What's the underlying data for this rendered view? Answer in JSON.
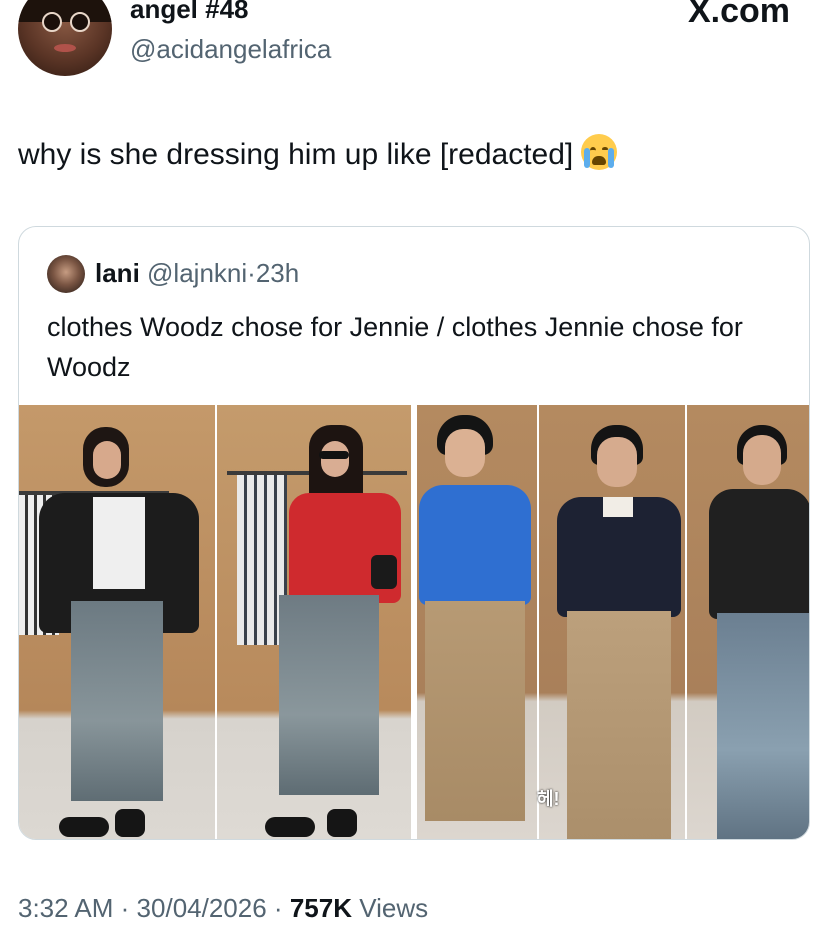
{
  "author": {
    "display_name": "angel #48",
    "handle": "@acidangelafrica"
  },
  "brand": "X.com",
  "tweet": {
    "text": "why is she dressing him up like [redacted]",
    "emoji": "loudly-crying-face"
  },
  "quoted_tweet": {
    "name": "lani",
    "handle": "@lajnkni",
    "separator": "·",
    "age": "23h",
    "text": "clothes Woodz chose for Jennie / clothes Jennie chose for Woodz"
  },
  "photos": [
    {
      "subject": "woman in leather jacket and denim maxi skirt"
    },
    {
      "subject": "woman in red cardigan and denim maxi skirt"
    },
    {
      "subject": "man in blue polo and khaki trousers; man in navy polo and khaki trousers; man in black top and jeans",
      "overlay_text": "헤!"
    }
  ],
  "meta": {
    "time": "3:32 AM",
    "date": "30/04/2026",
    "views_count": "757K",
    "views_label": "Views",
    "separator": "·"
  },
  "colors": {
    "text_primary": "#0f1419",
    "text_secondary": "#536471",
    "border": "#cfd9de"
  }
}
